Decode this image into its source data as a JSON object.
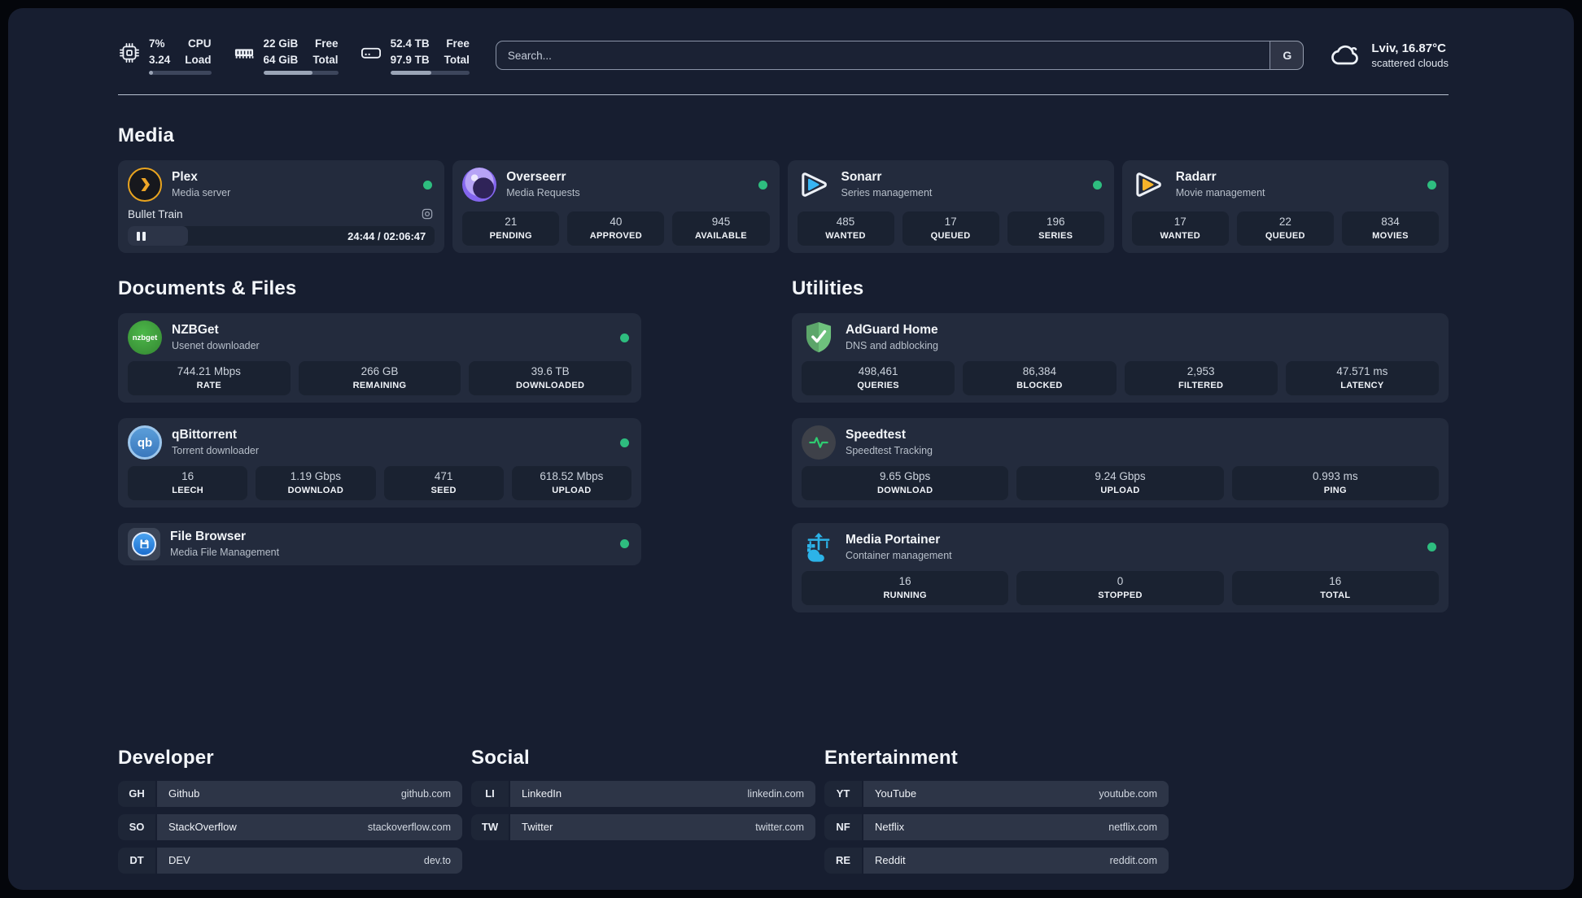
{
  "colors": {
    "background": "#171e30",
    "card": "#232b3d",
    "stat_cell": "#1a2231",
    "status_online": "#2ebd7f",
    "plex": "#eea628",
    "overseerr": "#8466ee",
    "sonarr": "#38b5f3",
    "radarr": "#f6b32a",
    "nzbget": "#3fa53c",
    "qbittorrent": "#4a90d9",
    "filebrowser": "#2a7fd4",
    "adguard": "#66b274",
    "speedtest_pulse": "#2ecc71",
    "portainer": "#2cb3e8"
  },
  "header": {
    "cpu": {
      "usage": "7%",
      "load": "3.24",
      "label_usage": "CPU",
      "label_load": "Load",
      "progress_percent": 7
    },
    "ram": {
      "free": "22 GiB",
      "total": "64 GiB",
      "label_free": "Free",
      "label_total": "Total",
      "progress_percent": 66
    },
    "disk": {
      "free": "52.4 TB",
      "total": "97.9 TB",
      "label_free": "Free",
      "label_total": "Total",
      "progress_percent": 52
    },
    "search": {
      "placeholder": "Search...",
      "engine_badge": "G"
    },
    "weather": {
      "location_temp": "Lviv, 16.87°C",
      "condition": "scattered clouds"
    }
  },
  "media": {
    "title": "Media",
    "plex": {
      "name": "Plex",
      "subtitle": "Media server",
      "online": true,
      "player": {
        "title": "Bullet Train",
        "time": "24:44 / 02:06:47",
        "progress_percent": 19.5
      }
    },
    "overseerr": {
      "name": "Overseerr",
      "subtitle": "Media Requests",
      "online": true,
      "stats": [
        {
          "value": "21",
          "label": "PENDING"
        },
        {
          "value": "40",
          "label": "APPROVED"
        },
        {
          "value": "945",
          "label": "AVAILABLE"
        }
      ]
    },
    "sonarr": {
      "name": "Sonarr",
      "subtitle": "Series management",
      "online": true,
      "stats": [
        {
          "value": "485",
          "label": "WANTED"
        },
        {
          "value": "17",
          "label": "QUEUED"
        },
        {
          "value": "196",
          "label": "SERIES"
        }
      ]
    },
    "radarr": {
      "name": "Radarr",
      "subtitle": "Movie management",
      "online": true,
      "stats": [
        {
          "value": "17",
          "label": "WANTED"
        },
        {
          "value": "22",
          "label": "QUEUED"
        },
        {
          "value": "834",
          "label": "MOVIES"
        }
      ]
    }
  },
  "documents": {
    "title": "Documents & Files",
    "nzbget": {
      "name": "NZBGet",
      "subtitle": "Usenet downloader",
      "online": true,
      "icon_text": "nzbget",
      "stats": [
        {
          "value": "744.21 Mbps",
          "label": "RATE"
        },
        {
          "value": "266 GB",
          "label": "REMAINING"
        },
        {
          "value": "39.6 TB",
          "label": "DOWNLOADED"
        }
      ]
    },
    "qbittorrent": {
      "name": "qBittorrent",
      "subtitle": "Torrent downloader",
      "online": true,
      "icon_text": "qb",
      "stats": [
        {
          "value": "16",
          "label": "LEECH"
        },
        {
          "value": "1.19 Gbps",
          "label": "DOWNLOAD"
        },
        {
          "value": "471",
          "label": "SEED"
        },
        {
          "value": "618.52 Mbps",
          "label": "UPLOAD"
        }
      ]
    },
    "filebrowser": {
      "name": "File Browser",
      "subtitle": "Media File Management",
      "online": true
    }
  },
  "utilities": {
    "title": "Utilities",
    "adguard": {
      "name": "AdGuard Home",
      "subtitle": "DNS and adblocking",
      "stats": [
        {
          "value": "498,461",
          "label": "QUERIES"
        },
        {
          "value": "86,384",
          "label": "BLOCKED"
        },
        {
          "value": "2,953",
          "label": "FILTERED"
        },
        {
          "value": "47.571 ms",
          "label": "LATENCY"
        }
      ]
    },
    "speedtest": {
      "name": "Speedtest",
      "subtitle": "Speedtest Tracking",
      "stats": [
        {
          "value": "9.65 Gbps",
          "label": "DOWNLOAD"
        },
        {
          "value": "9.24 Gbps",
          "label": "UPLOAD"
        },
        {
          "value": "0.993 ms",
          "label": "PING"
        }
      ]
    },
    "portainer": {
      "name": "Media Portainer",
      "subtitle": "Container management",
      "online": true,
      "stats": [
        {
          "value": "16",
          "label": "RUNNING"
        },
        {
          "value": "0",
          "label": "STOPPED"
        },
        {
          "value": "16",
          "label": "TOTAL"
        }
      ]
    }
  },
  "bookmarks": {
    "developer": {
      "title": "Developer",
      "links": [
        {
          "abbr": "GH",
          "name": "Github",
          "url": "github.com"
        },
        {
          "abbr": "SO",
          "name": "StackOverflow",
          "url": "stackoverflow.com"
        },
        {
          "abbr": "DT",
          "name": "DEV",
          "url": "dev.to"
        }
      ]
    },
    "social": {
      "title": "Social",
      "links": [
        {
          "abbr": "LI",
          "name": "LinkedIn",
          "url": "linkedin.com"
        },
        {
          "abbr": "TW",
          "name": "Twitter",
          "url": "twitter.com"
        }
      ]
    },
    "entertainment": {
      "title": "Entertainment",
      "links": [
        {
          "abbr": "YT",
          "name": "YouTube",
          "url": "youtube.com"
        },
        {
          "abbr": "NF",
          "name": "Netflix",
          "url": "netflix.com"
        },
        {
          "abbr": "RE",
          "name": "Reddit",
          "url": "reddit.com"
        }
      ]
    }
  }
}
